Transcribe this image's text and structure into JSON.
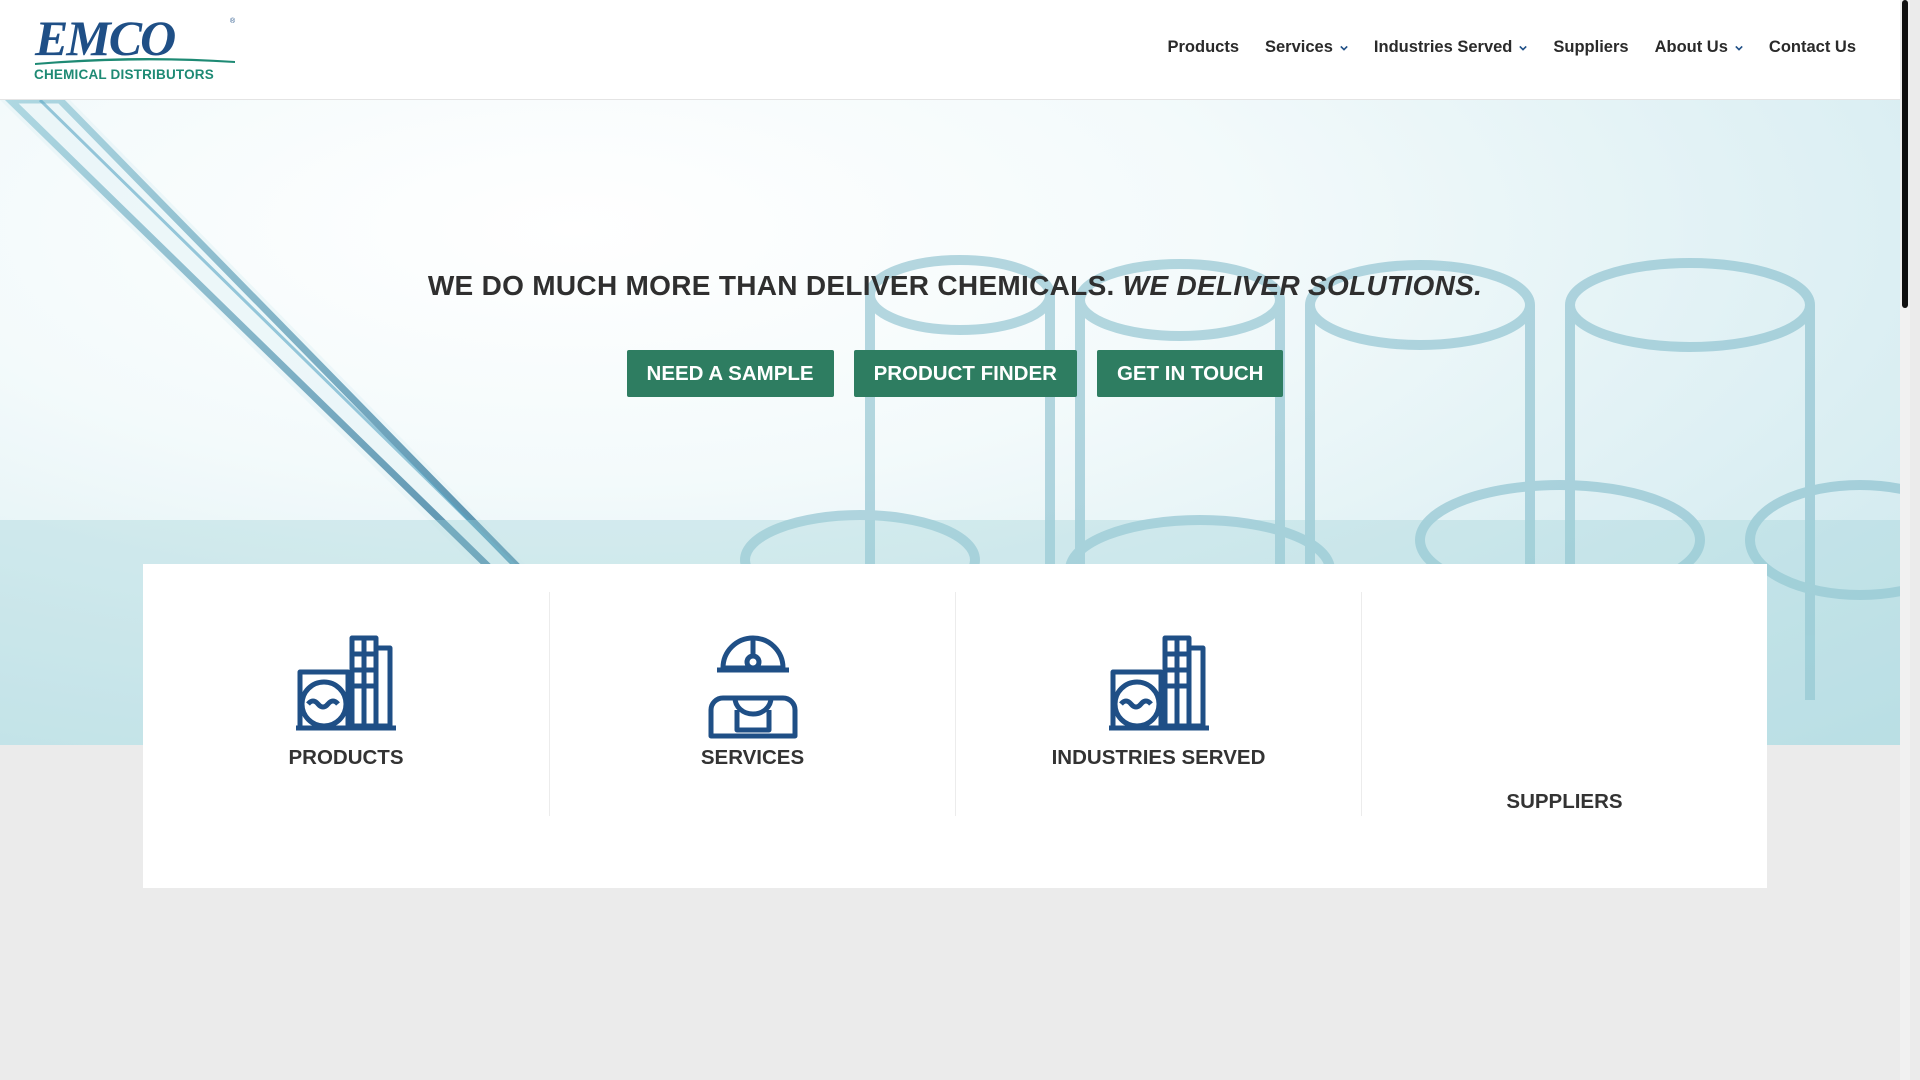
{
  "brand": {
    "logo_text": "EMCO",
    "logo_subtitle": "CHEMICAL DISTRIBUTORS",
    "registered_mark": "®",
    "primary_color": "#1f4f86",
    "accent_color": "#1e8a74",
    "button_color": "#2e7d61"
  },
  "nav": {
    "items": [
      {
        "label": "Products",
        "has_dropdown": false
      },
      {
        "label": "Services",
        "has_dropdown": true
      },
      {
        "label": "Industries Served",
        "has_dropdown": true
      },
      {
        "label": "Suppliers",
        "has_dropdown": false
      },
      {
        "label": "About Us",
        "has_dropdown": true
      },
      {
        "label": "Contact Us",
        "has_dropdown": false
      }
    ]
  },
  "hero": {
    "title_main": "WE DO MUCH MORE THAN DELIVER CHEMICALS.",
    "title_emphasis": "WE DELIVER SOLUTIONS.",
    "buttons": [
      "NEED A SAMPLE",
      "PRODUCT FINDER",
      "GET IN TOUCH"
    ]
  },
  "cards": [
    {
      "label": "PRODUCTS",
      "icon": "chemical-plant-icon"
    },
    {
      "label": "SERVICES",
      "icon": "worker-hardhat-icon"
    },
    {
      "label": "INDUSTRIES SERVED",
      "icon": "chemical-plant-icon"
    },
    {
      "label": "SUPPLIERS",
      "icon": ""
    }
  ]
}
